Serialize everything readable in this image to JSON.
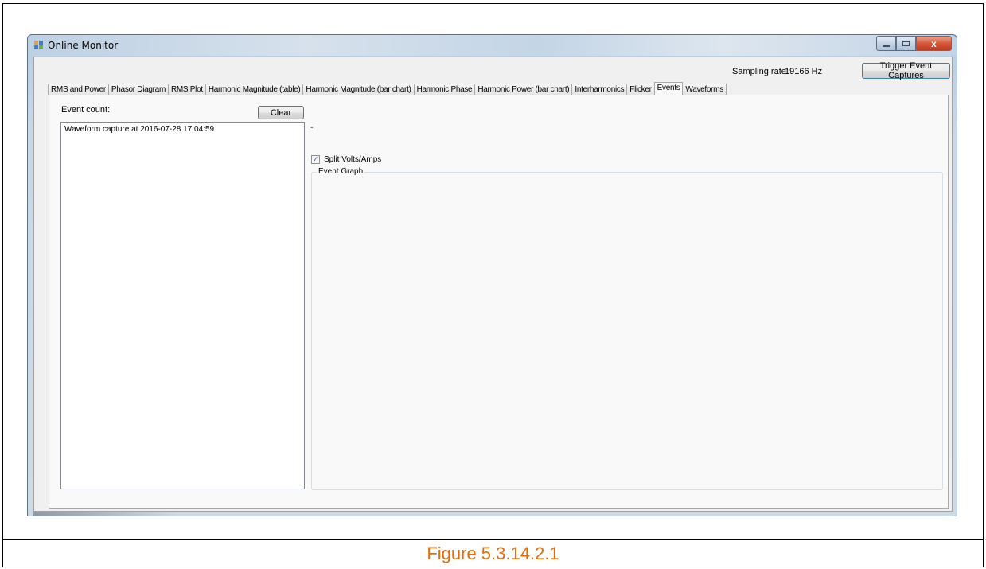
{
  "window": {
    "title": "Online Monitor",
    "controls": {
      "minimize": "",
      "maximize": "",
      "close": "x"
    }
  },
  "header": {
    "sampling_label": "Sampling rate:",
    "sampling_value": "19166 Hz",
    "trigger_button": "Trigger Event Captures"
  },
  "tabs": [
    {
      "label": "RMS and Power"
    },
    {
      "label": "Phasor Diagram"
    },
    {
      "label": "RMS Plot"
    },
    {
      "label": "Harmonic Magnitude (table)"
    },
    {
      "label": "Harmonic Magnitude (bar chart)"
    },
    {
      "label": "Harmonic Phase"
    },
    {
      "label": "Harmonic Power (bar chart)"
    },
    {
      "label": "Interharmonics"
    },
    {
      "label": "Flicker"
    },
    {
      "label": "Events"
    },
    {
      "label": "Waveforms"
    }
  ],
  "active_tab": "Events",
  "events": {
    "count_label": "Event count:",
    "clear_button": "Clear",
    "items": [
      "Waveform capture at 2016-07-28 17:04:59"
    ],
    "detail_text": "-",
    "split_label": "Split Volts/Amps",
    "split_checked": true,
    "graph_label": "Event Graph"
  },
  "caption": "Figure 5.3.14.2.1",
  "colors": {
    "caption": "#e36c0a",
    "close_button": "#c8452b",
    "accent_border": "#3c7fb1"
  }
}
